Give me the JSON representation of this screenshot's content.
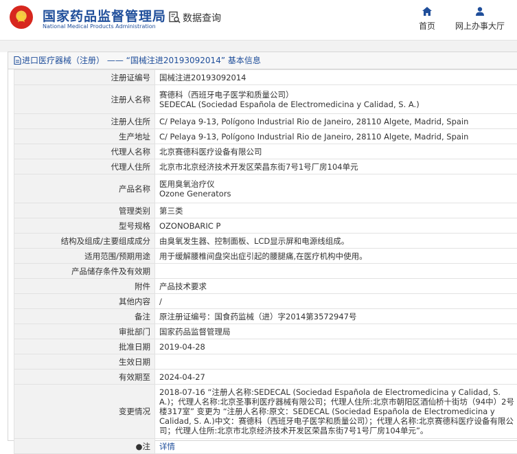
{
  "header": {
    "org_name_cn": "国家药品监督管理局",
    "org_name_en": "National Medical Products Administration",
    "query_label": "数据查询",
    "nav": [
      {
        "label": "首页",
        "icon": "home-icon"
      },
      {
        "label": "网上办事大厅",
        "icon": "user-icon"
      }
    ]
  },
  "panel": {
    "title": "进口医疗器械（注册） —— “国械注进20193092014” 基本信息"
  },
  "colors": {
    "brand_blue": "#1f4e9a",
    "label_bg": "#f2f2f2"
  },
  "rows": [
    {
      "label": "注册证编号",
      "value": "国械注进20193092014"
    },
    {
      "label": "注册人名称",
      "value": "赛德科（西班牙电子医学和质量公司）",
      "value2": "SEDECAL (Sociedad Española de Electromedicina y Calidad, S. A.)"
    },
    {
      "label": "注册人住所",
      "value": "C/ Pelaya 9-13, Polígono Industrial Rio de Janeiro, 28110 Algete, Madrid, Spain"
    },
    {
      "label": "生产地址",
      "value": "C/ Pelaya 9-13, Polígono Industrial Rio de Janeiro, 28110 Algete, Madrid, Spain"
    },
    {
      "label": "代理人名称",
      "value": "北京赛德科医疗设备有限公司"
    },
    {
      "label": "代理人住所",
      "value": "北京市北京经济技术开发区荣昌东街7号1号厂房104单元"
    },
    {
      "label": "产品名称",
      "value": "医用臭氧治疗仪",
      "value2": "Ozone Generators"
    },
    {
      "label": "管理类别",
      "value": "第三类"
    },
    {
      "label": "型号规格",
      "value": "OZONOBARIC P"
    },
    {
      "label": "结构及组成/主要组成成分",
      "value": "由臭氧发生器、控制面板、LCD显示屏和电源线组成。"
    },
    {
      "label": "适用范围/预期用途",
      "value": "用于缓解腰椎间盘突出症引起的腰腿痛,在医疗机构中使用。"
    },
    {
      "label": "产品储存条件及有效期",
      "value": ""
    },
    {
      "label": "附件",
      "value": "产品技术要求"
    },
    {
      "label": "其他内容",
      "value": "/"
    },
    {
      "label": "备注",
      "value": "原注册证编号：国食药监械（进）字2014第3572947号"
    },
    {
      "label": "审批部门",
      "value": "国家药品监督管理局"
    },
    {
      "label": "批准日期",
      "value": "2019-04-28"
    },
    {
      "label": "生效日期",
      "value": ""
    },
    {
      "label": "有效期至",
      "value": "2024-04-27"
    },
    {
      "label": "变更情况",
      "value": "2018-07-16 “注册人名称:SEDECAL (Sociedad Española de Electromedicina y Calidad, S. A.)；代理人名称:北京圣事利医疗器械有限公司；代理人住所:北京市朝阳区酒仙桥十街坊（94中）2号楼317室” 变更为 “注册人名称:原文：SEDECAL (Sociedad Española de Electromedicina y Calidad, S. A.)中文：赛德科（西班牙电子医学和质量公司）；代理人名称:北京赛德科医疗设备有限公司；代理人住所:北京市北京经济技术开发区荣昌东街7号1号厂房104单元”。"
    },
    {
      "label": "注",
      "value": "详情"
    }
  ]
}
